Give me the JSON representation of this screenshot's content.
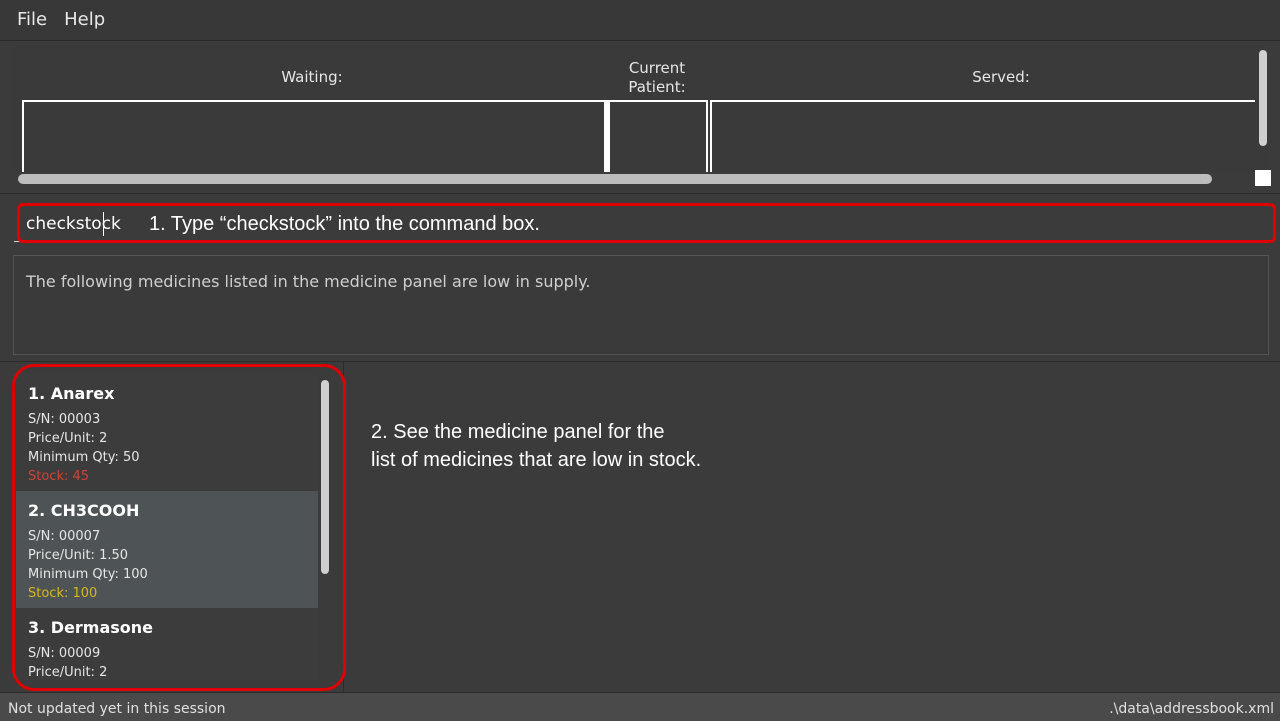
{
  "menu": {
    "file": "File",
    "help": "Help"
  },
  "queue": {
    "waiting_label": "Waiting:",
    "current_label_line1": "Current",
    "current_label_line2": "Patient:",
    "served_label": "Served:"
  },
  "command": {
    "value": "checkstock"
  },
  "annotations": {
    "step1": "1. Type “checkstock” into the command box.",
    "step2_line1": "2. See the medicine panel for the",
    "step2_line2": "list of medicines that are low in stock."
  },
  "result": {
    "text": "The following medicines listed in the medicine panel are low in supply."
  },
  "medicines": [
    {
      "title": "1.  Anarex",
      "serial": "S/N: 00003",
      "price": "Price/Unit: 2",
      "min_qty": "Minimum Qty: 50",
      "stock": "Stock: 45",
      "stock_color": "#d04438"
    },
    {
      "title": "2.  CH3COOH",
      "serial": "S/N: 00007",
      "price": "Price/Unit: 1.50",
      "min_qty": "Minimum Qty: 100",
      "stock": "Stock: 100",
      "stock_color": "#d9b61b"
    },
    {
      "title": "3.  Dermasone",
      "serial": "S/N: 00009",
      "price": "Price/Unit: 2"
    }
  ],
  "status": {
    "left": "Not updated yet in this session",
    "right": ".\\data\\addressbook.xml"
  },
  "colors": {
    "annotation": "#e00000",
    "background": "#3b3b3b",
    "selected_card": "#4e5356"
  }
}
